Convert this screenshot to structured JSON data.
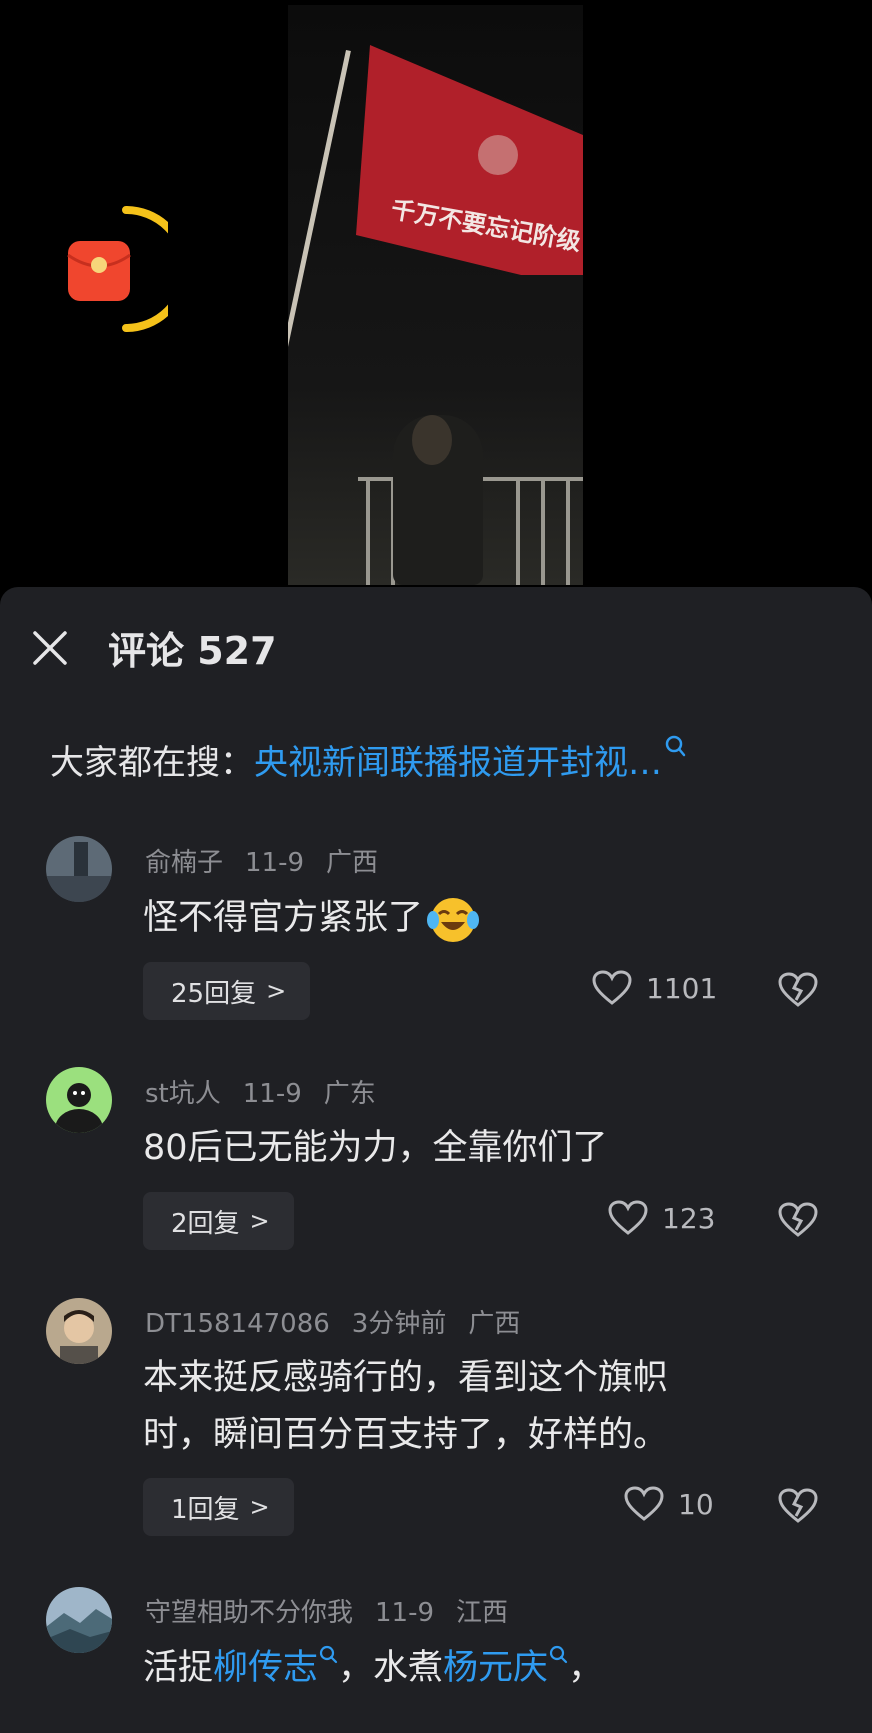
{
  "video": {
    "flag_text": "千万不要忘记阶级"
  },
  "header": {
    "title": "评论 527"
  },
  "search": {
    "prefix": "大家都在搜：",
    "query": "央视新闻联播报道开封视…"
  },
  "comments": [
    {
      "username": "俞楠子",
      "date": "11-9",
      "location": "广西",
      "text": "怪不得官方紧张了",
      "emoji": "laughing-tears-icon",
      "replies": "25回复",
      "likes": "1101"
    },
    {
      "username": "st坑人",
      "date": "11-9",
      "location": "广东",
      "text": "80后已无能为力，全靠你们了",
      "replies": "2回复",
      "likes": "123"
    },
    {
      "username": "DT158147086",
      "date": "3分钟前",
      "location": "广西",
      "text_line1": "本来挺反感骑行的，看到这个旗帜",
      "text_line2": "时，瞬间百分百支持了，好样的。",
      "replies": "1回复",
      "likes": "10"
    },
    {
      "username": "守望相助不分你我",
      "date": "11-9",
      "location": "江西",
      "text_a": "活捉",
      "link_a": "柳传志",
      "text_b": "，水煮",
      "link_b": "杨元庆",
      "text_c": "，"
    }
  ],
  "colors": {
    "sheet_bg": "#1f2024",
    "link": "#2f9bf0",
    "meta": "#8d8e93",
    "reply_bg": "#2c2d32",
    "flag": "#b0202a",
    "redpacket": "#f0462e",
    "timer_ring": "#f5c21a"
  }
}
